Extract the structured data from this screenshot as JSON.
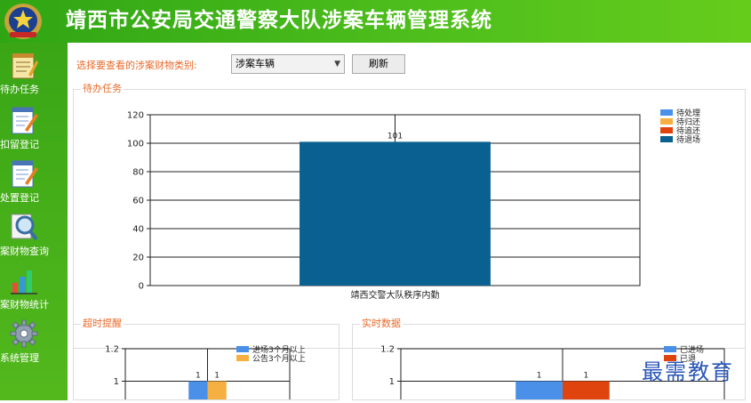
{
  "app": {
    "title": "靖西市公安局交通警察大队涉案车辆管理系统"
  },
  "sidebar": {
    "items": [
      {
        "label": "待办任务",
        "icon": "notepad-icon"
      },
      {
        "label": "扣留登记",
        "icon": "form-edit-icon"
      },
      {
        "label": "处置登记",
        "icon": "form-edit-icon"
      },
      {
        "label": "案财物查询",
        "icon": "magnifier-icon"
      },
      {
        "label": "案财物统计",
        "icon": "bar-chart-icon"
      },
      {
        "label": "系统管理",
        "icon": "gear-icon"
      }
    ]
  },
  "filter": {
    "label": "选择要查看的涉案财物类别:",
    "selected": "涉案车辆",
    "refresh_label": "刷新"
  },
  "groups": {
    "pending": "待办任务",
    "overdue": "超时提醒",
    "realtime": "实时数据"
  },
  "watermark": "最需教育",
  "colors": {
    "brand_green": "#3fae17",
    "label_orange": "#e86a2a",
    "series_blue": "#4a90e8",
    "series_orange": "#f5b041",
    "series_red": "#e0440e",
    "series_navy": "#0a6090"
  },
  "chart_data": [
    {
      "type": "bar",
      "categories": [
        "靖西交警大队秩序内勤"
      ],
      "series": [
        {
          "name": "待处理",
          "values": [
            0
          ]
        },
        {
          "name": "待归还",
          "values": [
            0
          ]
        },
        {
          "name": "待追还",
          "values": [
            0
          ]
        },
        {
          "name": "待退场",
          "values": [
            101
          ]
        }
      ],
      "data_labels": [
        "101"
      ],
      "yticks": [
        0,
        20,
        40,
        60,
        80,
        100,
        120
      ],
      "ylim": [
        0,
        120
      ],
      "legend": "top-right",
      "grid": true
    },
    {
      "type": "bar",
      "categories": [
        ""
      ],
      "series": [
        {
          "name": "进场3个月以上",
          "values": [
            1
          ]
        },
        {
          "name": "公告3个月以上",
          "values": [
            1
          ]
        }
      ],
      "data_labels": [
        "1",
        "1"
      ],
      "yticks": [
        1,
        1.2
      ],
      "ylim": [
        0.8,
        1.2
      ],
      "legend": "top-right",
      "grid": true
    },
    {
      "type": "bar",
      "categories": [
        ""
      ],
      "series": [
        {
          "name": "已进场",
          "values": [
            1
          ]
        },
        {
          "name": "已退",
          "values": [
            1
          ]
        }
      ],
      "data_labels": [
        "1",
        "1"
      ],
      "yticks": [
        1,
        1.2
      ],
      "ylim": [
        0.8,
        1.2
      ],
      "legend": "top-right",
      "grid": true
    }
  ]
}
